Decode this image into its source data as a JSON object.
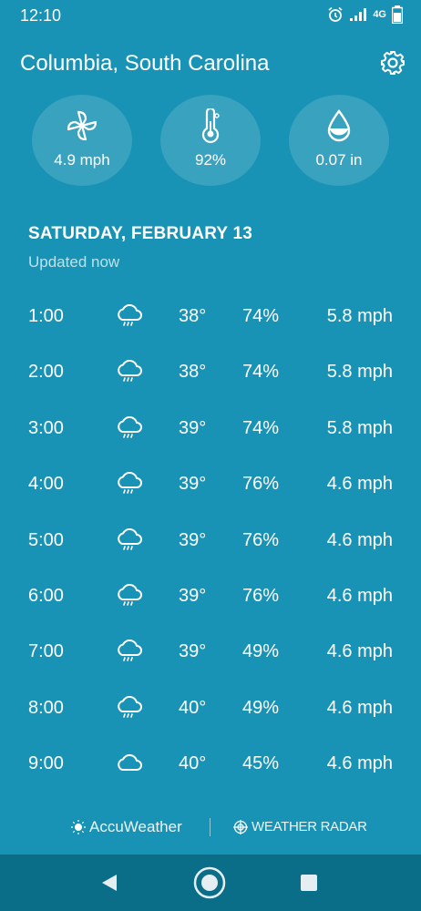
{
  "status_bar": {
    "time": "12:10",
    "network": "4G"
  },
  "header": {
    "location": "Columbia, South Carolina"
  },
  "current": {
    "wind": "4.9 mph",
    "humidity": "92%",
    "precipitation": "0.07 in"
  },
  "day": {
    "title": "SATURDAY, FEBRUARY 13",
    "updated": "Updated now"
  },
  "hourly": [
    {
      "time": "1:00",
      "icon": "rain-cloud-icon",
      "temp": "38°",
      "humidity": "74%",
      "wind": "5.8 mph"
    },
    {
      "time": "2:00",
      "icon": "rain-cloud-icon",
      "temp": "38°",
      "humidity": "74%",
      "wind": "5.8 mph"
    },
    {
      "time": "3:00",
      "icon": "rain-cloud-icon",
      "temp": "39°",
      "humidity": "74%",
      "wind": "5.8 mph"
    },
    {
      "time": "4:00",
      "icon": "rain-cloud-icon",
      "temp": "39°",
      "humidity": "76%",
      "wind": "4.6 mph"
    },
    {
      "time": "5:00",
      "icon": "rain-cloud-icon",
      "temp": "39°",
      "humidity": "76%",
      "wind": "4.6 mph"
    },
    {
      "time": "6:00",
      "icon": "rain-cloud-icon",
      "temp": "39°",
      "humidity": "76%",
      "wind": "4.6 mph"
    },
    {
      "time": "7:00",
      "icon": "rain-cloud-icon",
      "temp": "39°",
      "humidity": "49%",
      "wind": "4.6 mph"
    },
    {
      "time": "8:00",
      "icon": "rain-cloud-icon",
      "temp": "40°",
      "humidity": "49%",
      "wind": "4.6 mph"
    },
    {
      "time": "9:00",
      "icon": "cloud-icon",
      "temp": "40°",
      "humidity": "45%",
      "wind": "4.6 mph"
    }
  ],
  "footer": {
    "accuweather": "AccuWeather",
    "radar": "WEATHER RADAR"
  },
  "colors": {
    "background": "#1893b5",
    "navbar": "#0b6e89"
  }
}
